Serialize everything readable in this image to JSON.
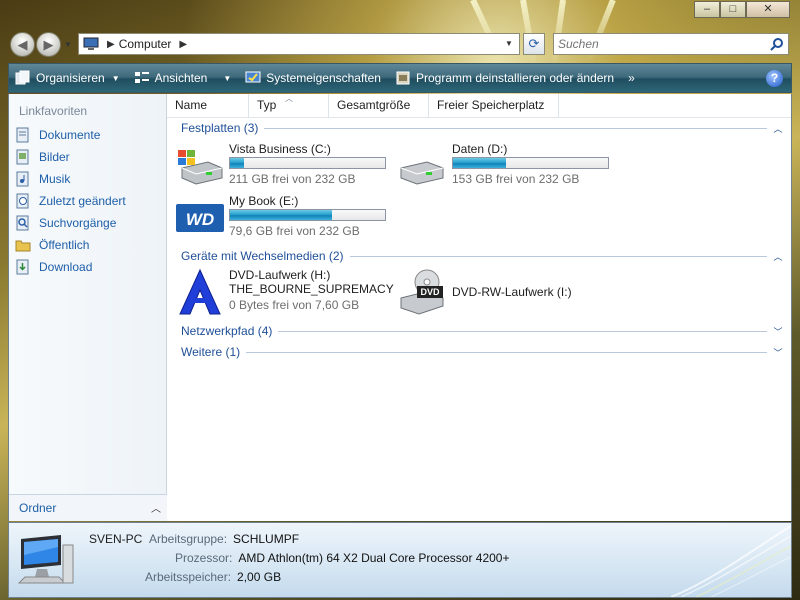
{
  "window": {
    "minimize_glyph": "–",
    "maximize_glyph": "□",
    "close_glyph": "✕"
  },
  "addressbar": {
    "location": "Computer",
    "search_placeholder": "Suchen",
    "icon": "computer-icon"
  },
  "toolbar": {
    "items": [
      {
        "label": "Organisieren",
        "icon": "organize-icon",
        "dropdown": true
      },
      {
        "label": "Ansichten",
        "icon": "views-icon",
        "dropdown": true
      },
      {
        "label": "Systemeigenschaften",
        "icon": "system-properties-icon",
        "dropdown": false
      },
      {
        "label": "Programm deinstallieren oder ändern",
        "icon": "uninstall-icon",
        "dropdown": false
      }
    ],
    "more_label": "»",
    "help_label": "?"
  },
  "navpane": {
    "header": "Linkfavoriten",
    "items": [
      {
        "label": "Dokumente",
        "icon": "documents-icon"
      },
      {
        "label": "Bilder",
        "icon": "pictures-icon"
      },
      {
        "label": "Musik",
        "icon": "music-icon"
      },
      {
        "label": "Zuletzt geändert",
        "icon": "recent-icon"
      },
      {
        "label": "Suchvorgänge",
        "icon": "searches-icon"
      },
      {
        "label": "Öffentlich",
        "icon": "public-folder-icon"
      },
      {
        "label": "Download",
        "icon": "download-icon"
      }
    ],
    "folders_label": "Ordner"
  },
  "columns": [
    "Name",
    "Typ",
    "Gesamtgröße",
    "Freier Speicherplatz"
  ],
  "groups": {
    "hard_drives": "Festplatten (3)",
    "removable": "Geräte mit Wechselmedien (2)",
    "network": "Netzwerkpfad (4)",
    "other": "Weitere (1)"
  },
  "drives": [
    {
      "name": "Vista Business (C:)",
      "free": "211 GB frei von 232 GB",
      "used_fraction": 0.09,
      "icon": "windows-drive-icon"
    },
    {
      "name": "Daten (D:)",
      "free": "153 GB frei von 232 GB",
      "used_fraction": 0.34,
      "icon": "hard-drive-icon"
    },
    {
      "name": "My Book (E:)",
      "free": "79,6 GB frei von 232 GB",
      "used_fraction": 0.66,
      "icon": "wd-drive-icon"
    }
  ],
  "removable": [
    {
      "name": "DVD-Laufwerk (H:)",
      "label": "THE_BOURNE_SUPREMACY",
      "free": "0 Bytes frei von 7,60 GB",
      "icon": "dvd-disc-icon"
    },
    {
      "name": "DVD-RW-Laufwerk (I:)",
      "icon": "dvd-rw-drive-icon",
      "badge": "DVD"
    }
  ],
  "details": {
    "pc_name": "SVEN-PC",
    "workgroup_label": "Arbeitsgruppe:",
    "workgroup": "SCHLUMPF",
    "processor_label": "Prozessor:",
    "processor": "AMD Athlon(tm) 64 X2 Dual Core Processor 4200+",
    "memory_label": "Arbeitsspeicher:",
    "memory": "2,00 GB"
  }
}
